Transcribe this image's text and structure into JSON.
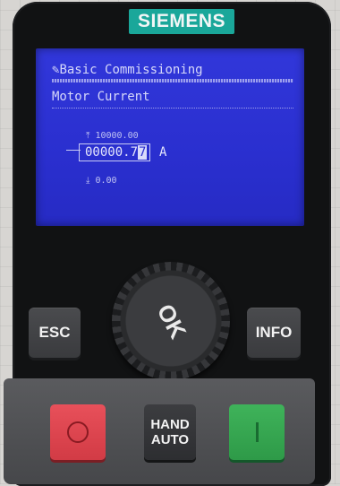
{
  "device": {
    "brand": "SIEMENS"
  },
  "screen": {
    "menu_icon": "wrench-icon",
    "menu_title": "Basic Commissioning",
    "parameter_name": "Motor Current",
    "max_icon": "upper-limit-icon",
    "max_value": "10000.00",
    "value_prefix": "00000.7",
    "value_cursor_digit": "7",
    "unit": "A",
    "min_icon": "lower-limit-icon",
    "min_value": "0.00"
  },
  "buttons": {
    "esc_label": "ESC",
    "info_label": "INFO",
    "knob_label": "OK",
    "hand_label": "HAND",
    "auto_label": "AUTO",
    "stop_icon": "circle-stop-icon",
    "start_icon": "bar-start-icon"
  },
  "colors": {
    "brand_badge": "#1aa79a",
    "lcd_background": "#2a2fcf",
    "stop_button": "#d23b45",
    "start_button": "#2e9a48"
  }
}
